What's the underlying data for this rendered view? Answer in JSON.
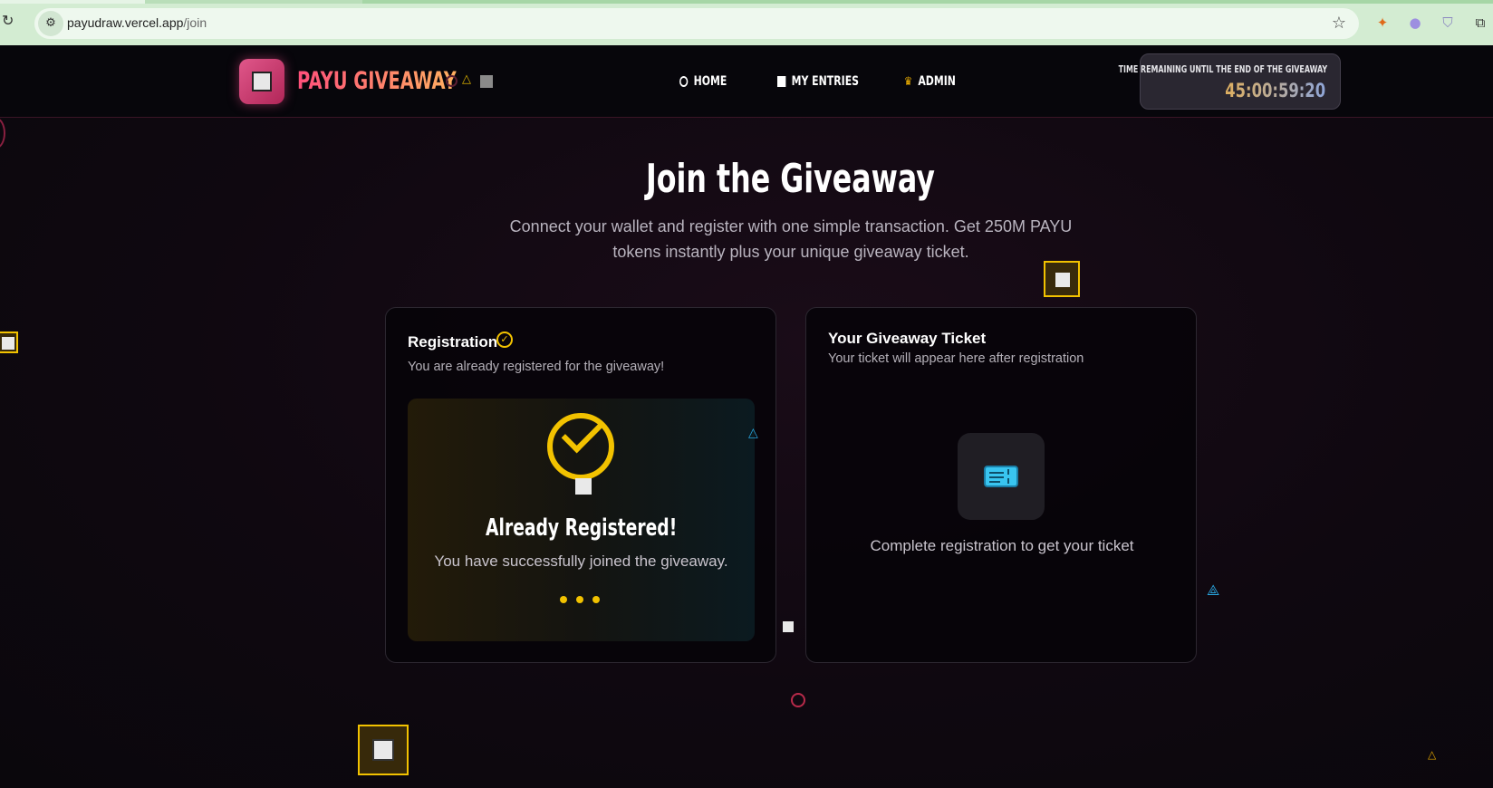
{
  "browser": {
    "url_host": "payudraw.vercel.app",
    "url_path": "/join",
    "reload_icon": "reload-icon",
    "star_icon": "star-icon"
  },
  "navbar": {
    "brand": "PAYU GIVEAWAY",
    "items": [
      {
        "label": "HOME",
        "icon": "circle-icon"
      },
      {
        "label": "MY ENTRIES",
        "icon": "square-icon"
      },
      {
        "label": "ADMIN",
        "icon": "crown-icon"
      }
    ],
    "timer_label": "TIME REMAINING UNTIL THE END OF THE GIVEAWAY",
    "timer_value": "45:00:59:20"
  },
  "hero": {
    "title": "Join the Giveaway",
    "subtitle": "Connect your wallet and register with one simple transaction. Get 250M PAYU tokens instantly plus your unique giveaway ticket."
  },
  "registration": {
    "title": "Registration",
    "description": "You are already registered for the giveaway!",
    "status_title": "Already Registered!",
    "status_text": "You have successfully joined the giveaway."
  },
  "ticket": {
    "title": "Your Giveaway Ticket",
    "description": "Your ticket will appear here after registration",
    "placeholder_text": "Complete registration to get your ticket"
  },
  "colors": {
    "accent_yellow": "#f2c200",
    "brand_pink": "#e0578a",
    "ticket_blue": "#39c5f0"
  }
}
